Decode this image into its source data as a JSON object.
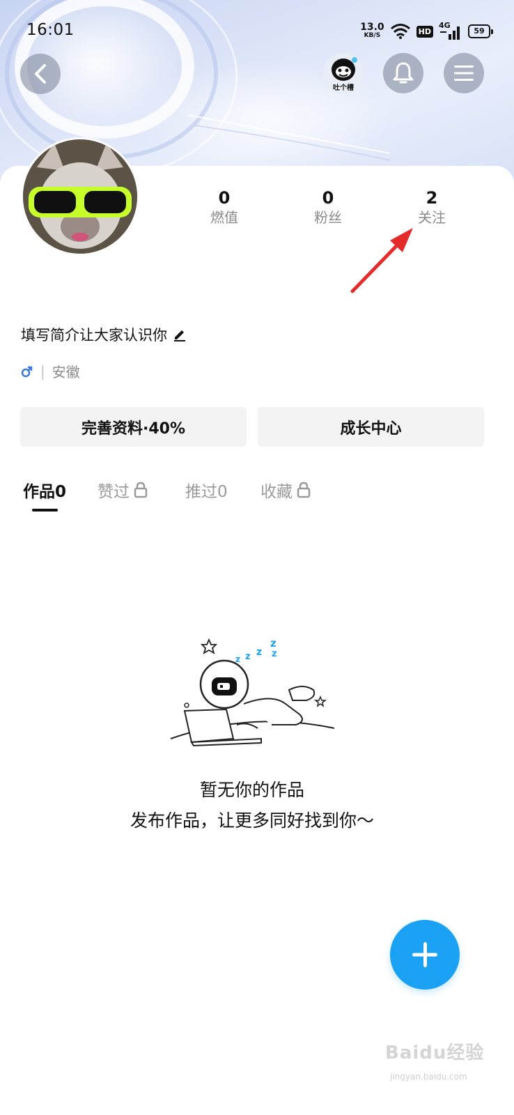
{
  "status_bar": {
    "time": "16:01",
    "net_speed_value": "13.0",
    "net_speed_unit": "KB/S",
    "hd_badge": "HD",
    "network_type": "4G",
    "battery_level": "59"
  },
  "header": {
    "tucao_label": "吐个槽"
  },
  "profile": {
    "stats": [
      {
        "value": "0",
        "label": "燃值"
      },
      {
        "value": "0",
        "label": "粉丝"
      },
      {
        "value": "2",
        "label": "关注"
      }
    ],
    "bio_placeholder": "填写简介让大家认识你",
    "location": "安徽",
    "gender_icon": "male-icon"
  },
  "actions": {
    "complete_profile": "完善资料·40%",
    "growth_center": "成长中心"
  },
  "tabs": [
    {
      "label": "作品0",
      "active": true,
      "locked": false
    },
    {
      "label": "赞过",
      "active": false,
      "locked": true
    },
    {
      "label": "推过0",
      "active": false,
      "locked": false
    },
    {
      "label": "收藏",
      "active": false,
      "locked": true
    }
  ],
  "empty_state": {
    "title": "暂无你的作品",
    "subtitle": "发布作品，让更多同好找到你～"
  },
  "watermark": {
    "brand": "Baidu经验",
    "url": "jingyan.baidu.com"
  },
  "colors": {
    "fab": "#1aa1f4",
    "annotation_arrow": "#e52a2a",
    "gender_icon": "#3a78e0"
  }
}
